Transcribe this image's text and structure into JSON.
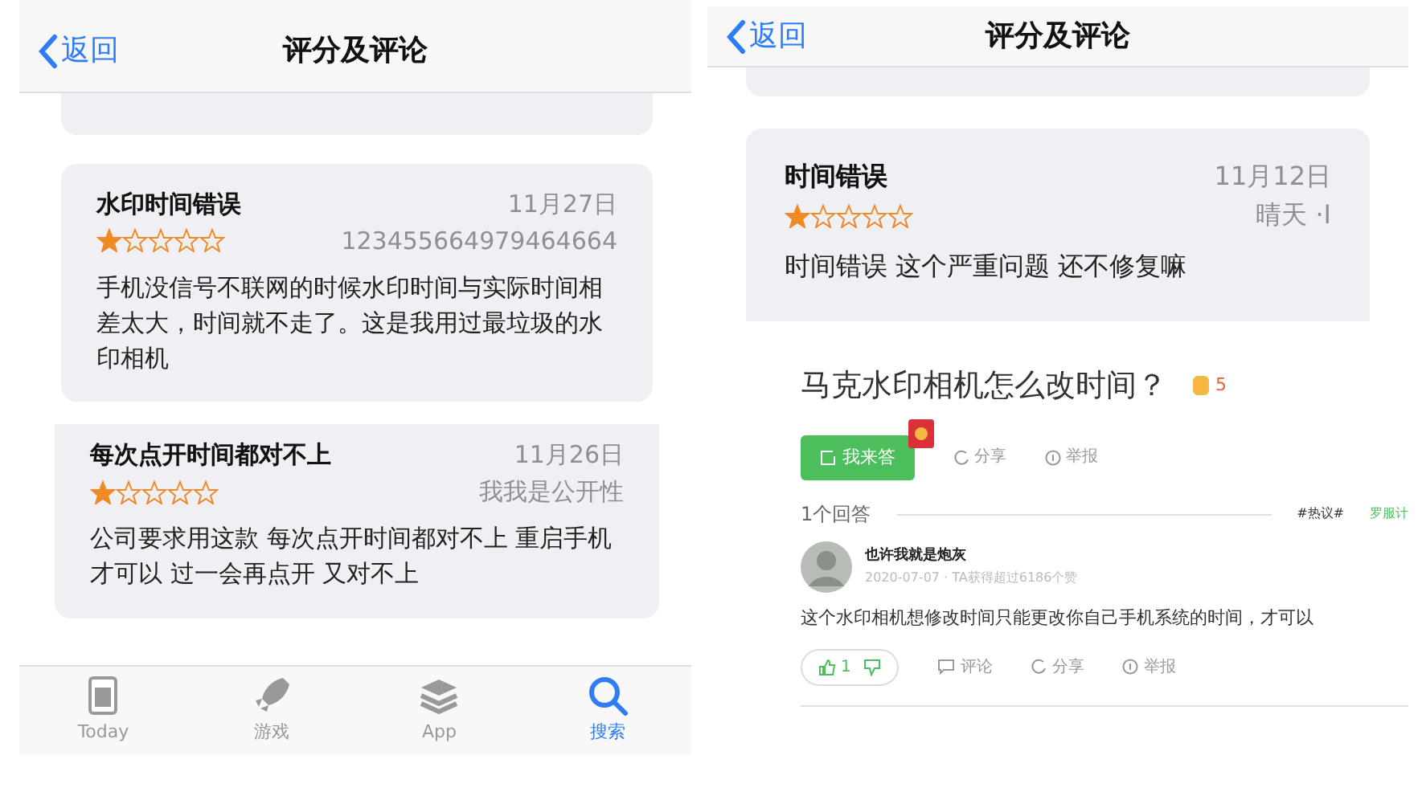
{
  "left": {
    "nav": {
      "back": "返回",
      "title": "评分及评论"
    },
    "reviews": [
      {
        "title": "水印时间错误",
        "date": "11月27日",
        "stars": 1,
        "author": "123455664979464664",
        "body": "手机没信号不联网的时候水印时间与实际时间相差太大，时间就不走了。这是我用过最垃圾的水印相机"
      },
      {
        "title": "每次点开时间都对不上",
        "date": "11月26日",
        "stars": 1,
        "author": "我我是公开性",
        "body": "公司要求用这款 每次点开时间都对不上 重启手机才可以 过一会再点开 又对不上"
      }
    ],
    "tab_bar": [
      {
        "label": "Today",
        "kind": "today",
        "selected": false
      },
      {
        "label": "游戏",
        "kind": "games",
        "selected": false
      },
      {
        "label": "App",
        "kind": "apps",
        "selected": false
      },
      {
        "label": "搜索",
        "kind": "search",
        "selected": true
      }
    ]
  },
  "right": {
    "nav": {
      "back": "返回",
      "title": "评分及评论"
    },
    "reviews": [
      {
        "title": "时间错误",
        "date": "11月12日",
        "stars": 1,
        "author": "晴天 ·I",
        "body": "时间错误  这个严重问题  还不修复嘛"
      }
    ],
    "question": {
      "title": "马克水印相机怎么改时间？",
      "reward": "5",
      "answer_button": "我来答",
      "share": "分享",
      "report": "举报"
    },
    "answers_header": {
      "count": "1个回答",
      "tag": "#热议#",
      "tag_link": "罗服计"
    },
    "answers": [
      {
        "name": "也许我就是炮灰",
        "meta": "2020-07-07 · TA获得超过6186个赞",
        "text": "这个水印相机想修改时间只能更改你自己手机系统的时间，才可以",
        "likes": "1",
        "comment": "评论",
        "share": "分享",
        "report": "举报"
      }
    ]
  }
}
